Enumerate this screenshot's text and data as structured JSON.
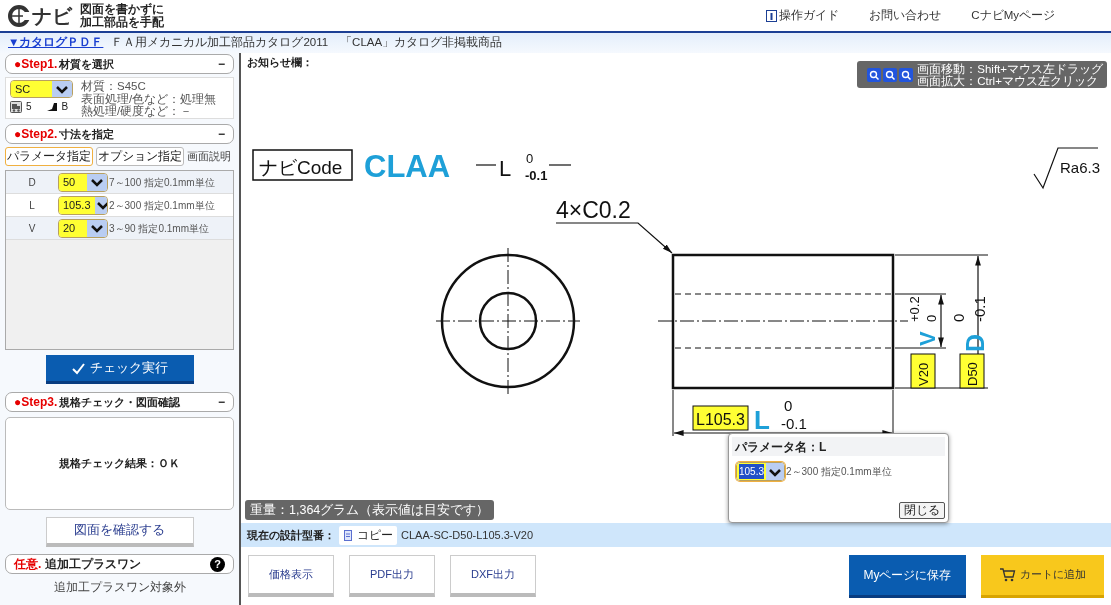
{
  "header": {
    "logo": "ナビ",
    "tagline": [
      "図面を書かずに",
      "加工部品を手配"
    ],
    "nav": [
      {
        "label": "操作ガイド",
        "kind": "guide"
      },
      {
        "label": "お問い合わせ",
        "kind": "plain"
      },
      {
        "label": "CナビMyページ",
        "kind": "plain"
      }
    ]
  },
  "catalog_bar": {
    "link": "▼カタログＰＤＦ",
    "text": "ＦＡ用メカニカル加工部品カタログ2011　「CLAA」カタログ非掲載商品"
  },
  "step1": {
    "badge": "●Step1.",
    "title": "材質を選択",
    "toggle": "−",
    "material": "SC",
    "details": [
      "材質：S45C",
      "表面処理/色など：処理無",
      "熱処理/硬度など：－"
    ],
    "days": "5",
    "rank": "B"
  },
  "step2": {
    "badge": "●Step2.",
    "title": "寸法を指定",
    "toggle": "−",
    "tabs": [
      {
        "label": "パラメータ指定",
        "selected": true
      },
      {
        "label": "オプション指定",
        "selected": false
      }
    ],
    "help": "画面説明",
    "params": [
      {
        "name": "D",
        "value": "50",
        "range": "7～100 指定0.1mm単位",
        "selected": false
      },
      {
        "name": "L",
        "value": "105.3",
        "range": "2～300 指定0.1mm単位",
        "selected": true
      },
      {
        "name": "V",
        "value": "20",
        "range": "3～90 指定0.1mm単位",
        "selected": false
      }
    ]
  },
  "check_button": "チェック実行",
  "step3": {
    "badge": "●Step3.",
    "title": "規格チェック・図面確認",
    "toggle": "−",
    "result": "規格チェック結果：ＯＫ",
    "confirm_button": "図面を確認する"
  },
  "optional": {
    "badge": "任意.",
    "title": "追加工プラスワン",
    "help": "?",
    "note": "追加工プラスワン対象外"
  },
  "notice_label": "お知らせ欄：",
  "zoom_hints": [
    "画面移動：Shift+マウス左ドラッグ",
    "画面拡大：Ctrl+マウス左クリック"
  ],
  "drawing": {
    "code_label": "ナビCode",
    "part_code": "CLAA",
    "header_dim": {
      "symbol": "L",
      "upper": "0",
      "lower": "-0.1"
    },
    "roughness": "Ra6.3",
    "chamfer": "4×C0.2",
    "v_dim": {
      "symbol": "V",
      "upper": "+0.2",
      "lower": "0",
      "value": "V20"
    },
    "d_dim": {
      "symbol": "D",
      "upper": "0",
      "lower": "-0.1",
      "value": "D50"
    },
    "l_dim": {
      "symbol": "L",
      "upper": "0",
      "lower": "-0.1",
      "value": "L105.3"
    }
  },
  "weight": "重量：1,364グラム（表示値は目安です）",
  "popup": {
    "title": "パラメータ名：L",
    "value": "105.3",
    "range": "2～300 指定0.1mm単位",
    "close": "閉じる"
  },
  "model_bar": {
    "label": "現在の設計型番：",
    "copy": "コピー",
    "value": "CLAA-SC-D50-L105.3-V20"
  },
  "actions": [
    {
      "label": "価格表示",
      "kind": "plain"
    },
    {
      "label": "PDF出力",
      "kind": "plain"
    },
    {
      "label": "DXF出力",
      "kind": "plain"
    },
    {
      "label": "Myページに保存",
      "kind": "save"
    },
    {
      "label": "カートに追加",
      "kind": "cart"
    }
  ]
}
